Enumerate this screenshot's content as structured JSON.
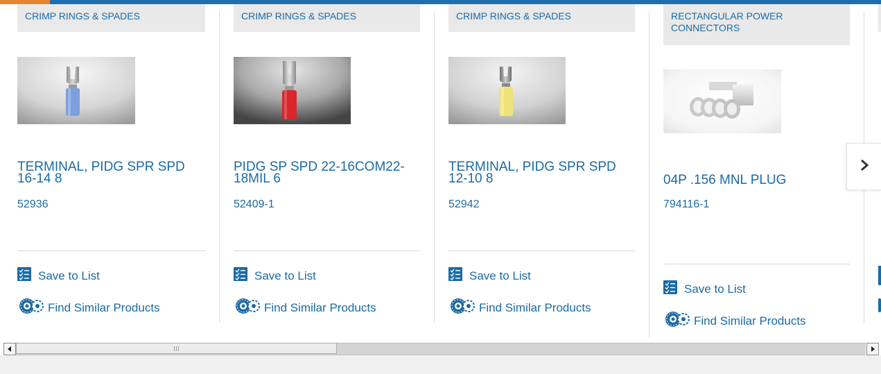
{
  "colors": {
    "link": "#1a6aa6",
    "category_bg": "#e9e9e9",
    "top_bar": "#1f6fae",
    "top_accent": "#e5862e"
  },
  "cards": [
    {
      "category": "CRIMP RINGS & SPADES",
      "title": "TERMINAL, PIDG SPR SPD 16-14 8",
      "part_number": "52936",
      "image_sleeve_color": "#7d9fdc",
      "save_label": "Save to List",
      "find_label": "Find Similar Products"
    },
    {
      "category": "CRIMP RINGS & SPADES",
      "title": "PIDG SP SPD 22-16COM22-18MIL 6",
      "part_number": "52409-1",
      "image_sleeve_color": "#d9262b",
      "save_label": "Save to List",
      "find_label": "Find Similar Products"
    },
    {
      "category": "CRIMP RINGS & SPADES",
      "title": "TERMINAL, PIDG SPR SPD 12-10 8",
      "part_number": "52942",
      "image_sleeve_color": "#eee37a",
      "save_label": "Save to List",
      "find_label": "Find Similar Products"
    },
    {
      "category": "RECTANGULAR POWER CONNECTORS",
      "title": "04P .156 MNL PLUG",
      "part_number": "794116-1",
      "save_label": "Save to List",
      "find_label": "Find Similar Products"
    }
  ],
  "icons": {
    "save": "checklist-icon",
    "find": "gears-icon",
    "next": "chevron-right-icon",
    "scroll_left": "arrow-left-icon",
    "scroll_right": "arrow-right-icon"
  },
  "scrollbar": {
    "position_fraction": 0.0,
    "visible_fraction": 0.38
  }
}
